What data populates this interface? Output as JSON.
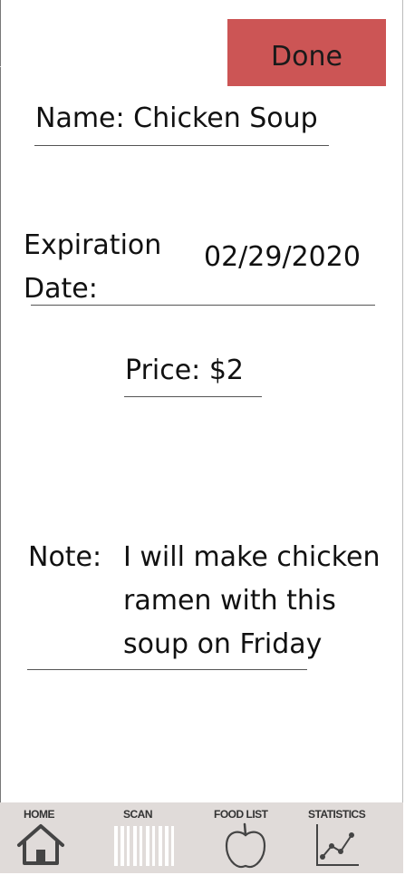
{
  "header": {
    "done_label": "Done"
  },
  "form": {
    "name": "Name: Chicken Soup",
    "expiration_label_line1": "Expiration",
    "expiration_label_line2": "Date:",
    "expiration_value": "02/29/2020",
    "price": "Price:  $2",
    "note_label": "Note:",
    "note_value": "I will make chicken ramen with this soup on Friday"
  },
  "nav": {
    "items": [
      {
        "label": "HOME",
        "icon": "home-icon"
      },
      {
        "label": "SCAN",
        "icon": "barcode-icon"
      },
      {
        "label": "FOOD LIST",
        "icon": "apple-icon"
      },
      {
        "label": "STATISTICS",
        "icon": "line-chart-icon"
      }
    ],
    "background": "#e0dbd9"
  },
  "colors": {
    "done_button": "#cc5555"
  }
}
